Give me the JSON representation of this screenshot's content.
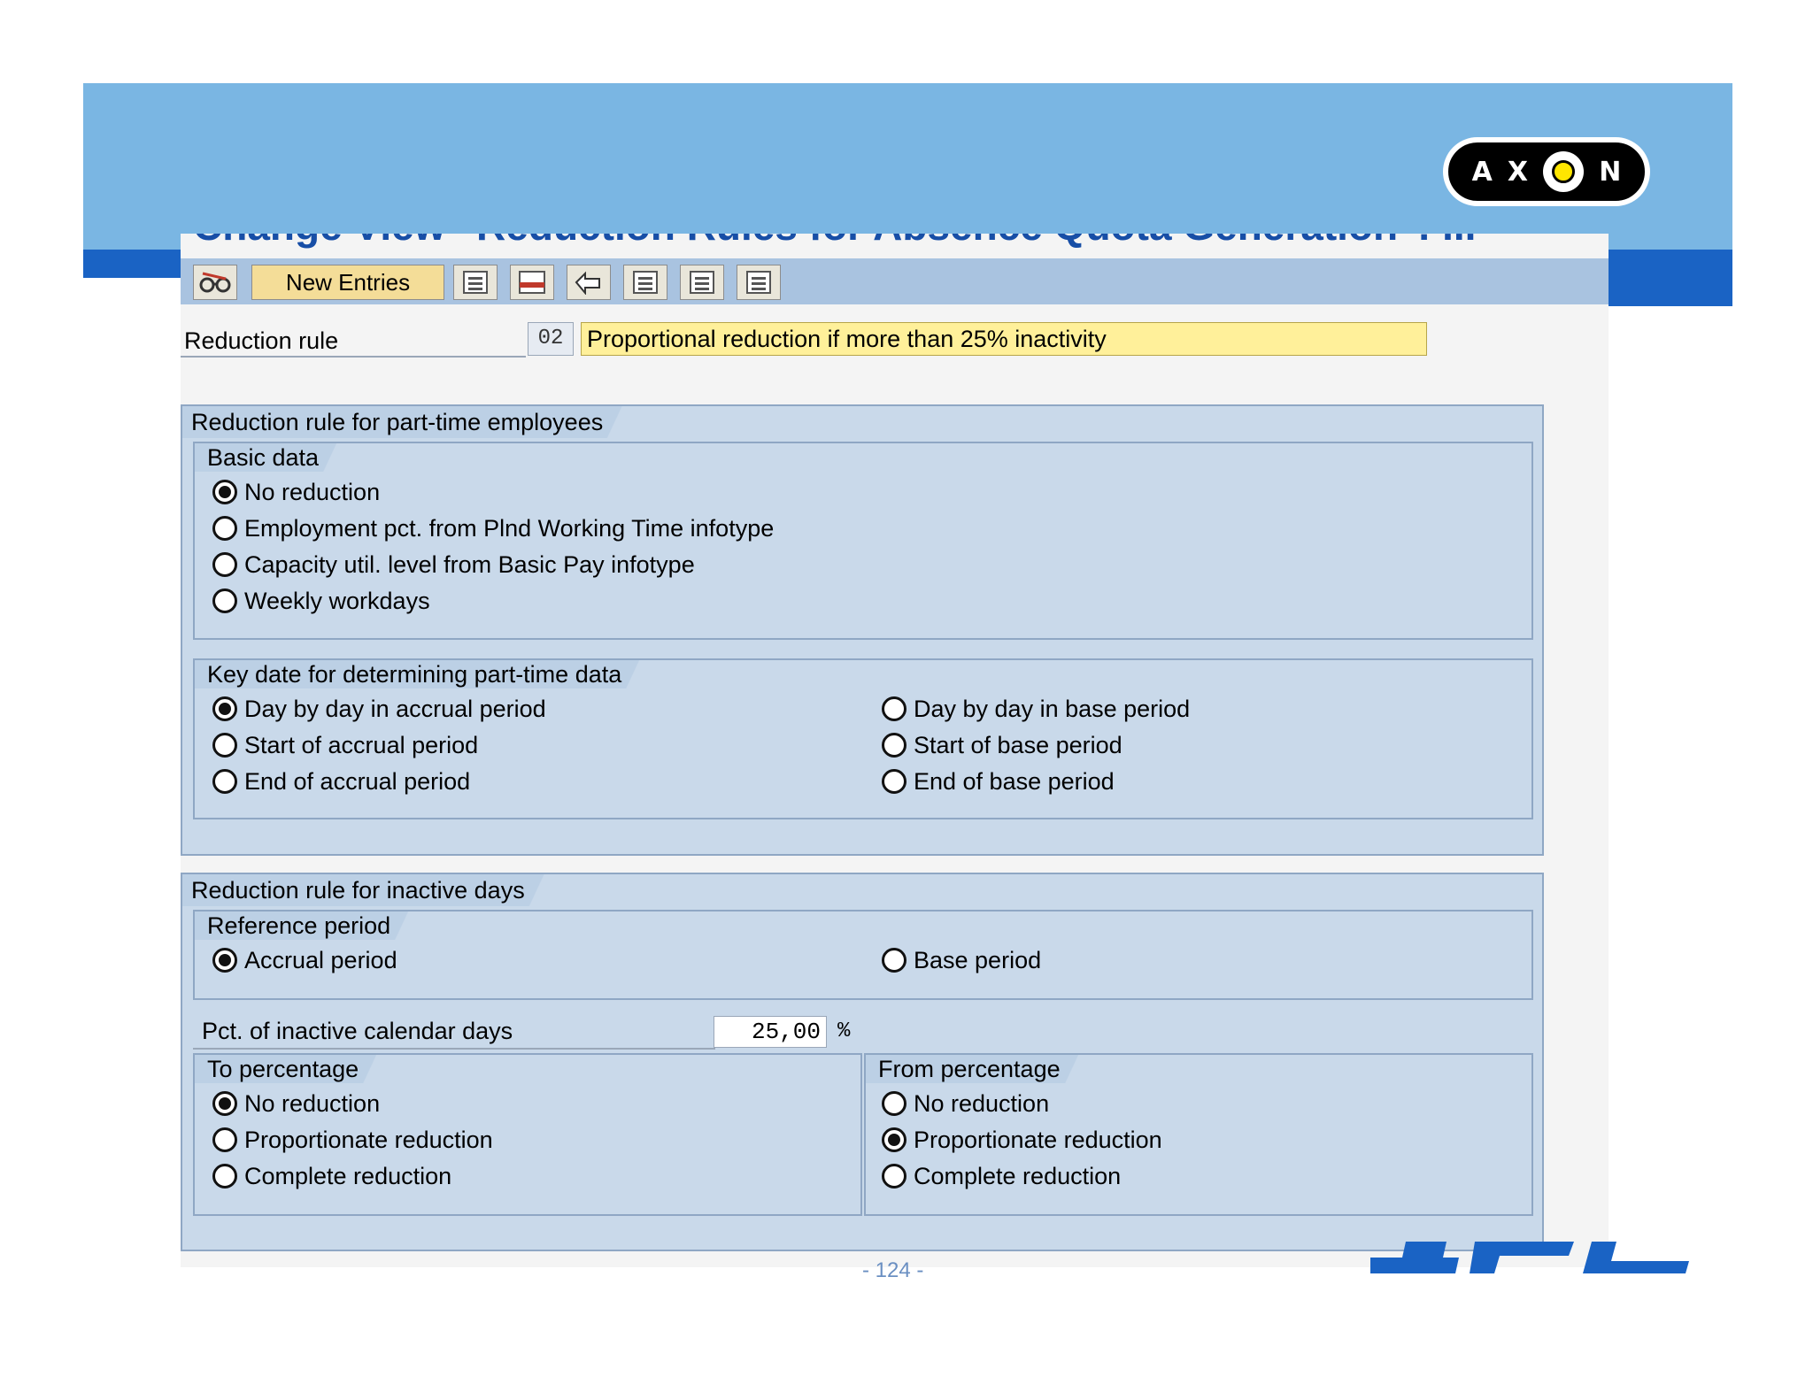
{
  "window": {
    "title": "Change View \"Reduction Rules for Absence Quota Generation\": ..."
  },
  "toolbar": {
    "new_entries_label": "New Entries",
    "icons": [
      "edit-glasses-icon",
      "copy-icon",
      "delete-icon",
      "undo-icon",
      "select-all-icon",
      "select-block-icon",
      "deselect-all-icon"
    ]
  },
  "reduction_rule": {
    "label": "Reduction rule",
    "code": "02",
    "description": "Proportional reduction if more than 25% inactivity"
  },
  "part_time": {
    "title": "Reduction rule for part-time employees",
    "basic_data": {
      "title": "Basic data",
      "options": [
        {
          "label": "No reduction",
          "selected": true
        },
        {
          "label": "Employment pct. from Plnd Working Time infotype",
          "selected": false
        },
        {
          "label": "Capacity util. level from Basic Pay infotype",
          "selected": false
        },
        {
          "label": "Weekly workdays",
          "selected": false
        }
      ]
    },
    "key_date": {
      "title": "Key date for determining part-time data",
      "left_options": [
        {
          "label": "Day by day in accrual period",
          "selected": true
        },
        {
          "label": "Start of accrual period",
          "selected": false
        },
        {
          "label": "End of accrual period",
          "selected": false
        }
      ],
      "right_options": [
        {
          "label": "Day by day in base period",
          "selected": false
        },
        {
          "label": "Start of base period",
          "selected": false
        },
        {
          "label": "End of base period",
          "selected": false
        }
      ]
    }
  },
  "inactive_days": {
    "title": "Reduction rule for inactive days",
    "reference_period": {
      "title": "Reference period",
      "options": [
        {
          "label": "Accrual period",
          "selected": true
        },
        {
          "label": "Base period",
          "selected": false
        }
      ]
    },
    "pct_inactive": {
      "label": "Pct. of inactive calendar days",
      "value": "25,00",
      "unit": "%"
    },
    "to_percentage": {
      "title": "To percentage",
      "options": [
        {
          "label": "No reduction",
          "selected": true
        },
        {
          "label": "Proportionate reduction",
          "selected": false
        },
        {
          "label": "Complete reduction",
          "selected": false
        }
      ]
    },
    "from_percentage": {
      "title": "From percentage",
      "options": [
        {
          "label": "No reduction",
          "selected": false
        },
        {
          "label": "Proportionate reduction",
          "selected": true
        },
        {
          "label": "Complete reduction",
          "selected": false
        }
      ]
    }
  },
  "footer": {
    "page_number": "- 124 -",
    "logo_text": "HCL"
  },
  "branding": {
    "logo_text": "AXON",
    "band_color": "#7ab6e3",
    "accent_blue": "#1a63c4",
    "logo_yellow": "#ffe600"
  }
}
